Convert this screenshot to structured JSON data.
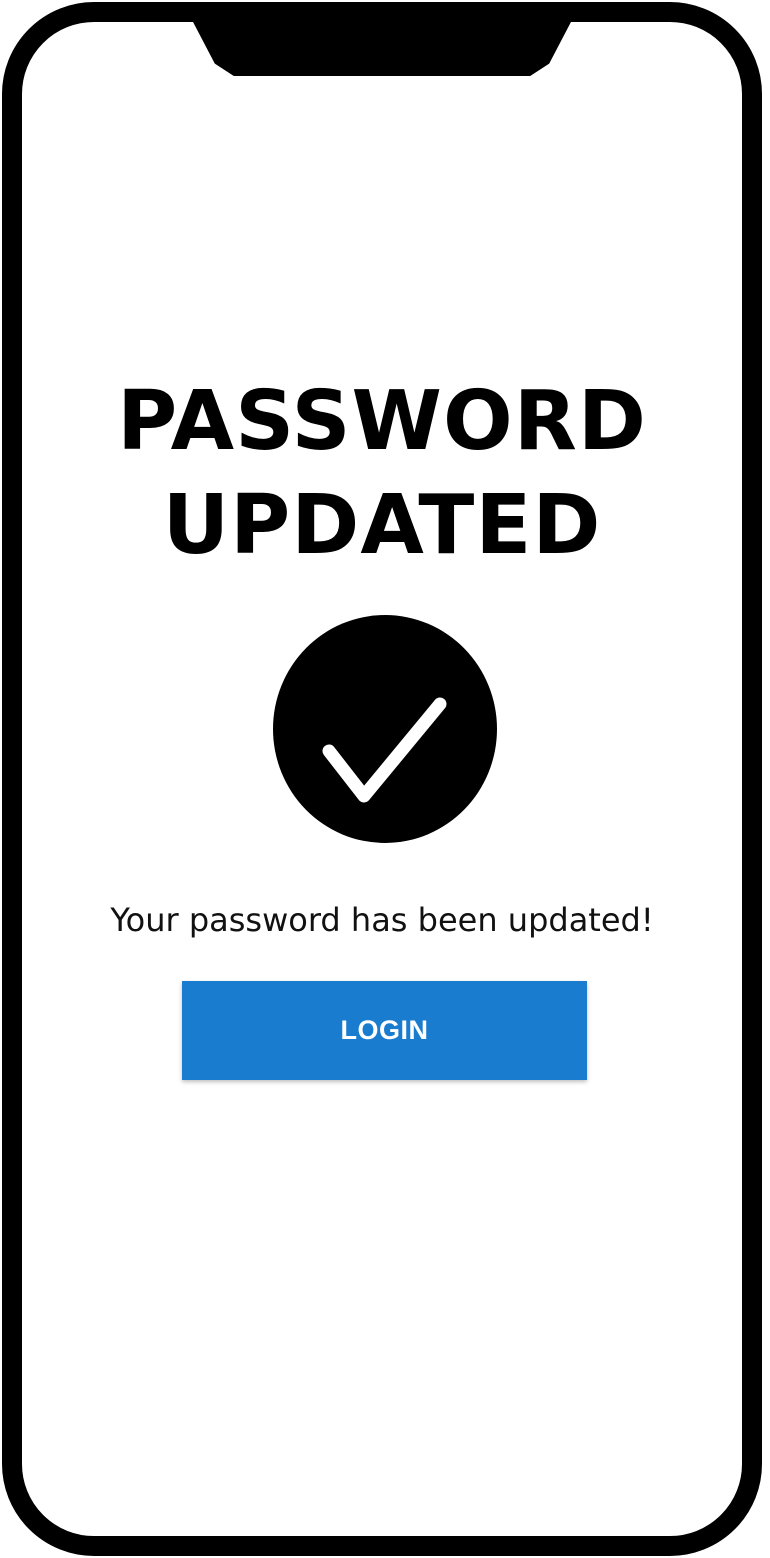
{
  "screen": {
    "title_line1": "PASSWORD",
    "title_line2": "UPDATED",
    "icon": "check-circle-icon",
    "message": "Your password has been updated!",
    "login_label": "LOGIN"
  },
  "colors": {
    "frame": "#000000",
    "button": "#1a7ccf",
    "button_text": "#ffffff"
  }
}
